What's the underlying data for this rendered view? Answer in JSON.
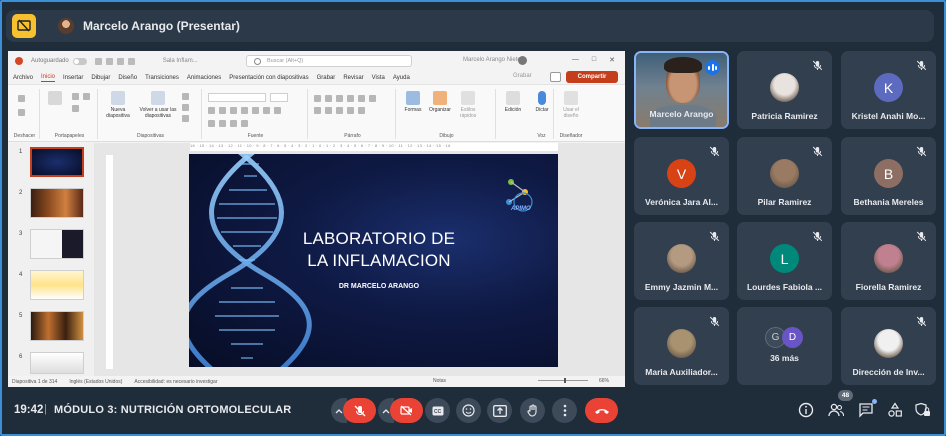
{
  "topbar": {
    "presenter_label": "Marcelo Arango (Presentar)"
  },
  "ppt": {
    "autosave_label": "Autoguardado",
    "filename": "Sala Inflam...",
    "search_placeholder": "Buscar (Alt+Q)",
    "user_name": "Marcelo Arango Nieto",
    "tabs": [
      "Archivo",
      "Inicio",
      "Insertar",
      "Dibujar",
      "Diseño",
      "Transiciones",
      "Animaciones",
      "Presentación con diapositivas",
      "Grabar",
      "Revisar",
      "Vista",
      "Ayuda"
    ],
    "grabar_label": "Grabar",
    "share_label": "Compartir",
    "ribbon": {
      "groups": [
        "Deshacer",
        "Portapapeles",
        "Diapositivas",
        "Fuente",
        "Párrafo",
        "Dibujo",
        "Voz",
        "Diseñador"
      ],
      "new_slide": "Nueva diapositiva",
      "reuse": "Volver a usar las diapositivas",
      "shapes": "Formas",
      "arrange": "Organizar",
      "quick_styles": "Estilos rápidos",
      "editing": "Edición",
      "dictate": "Dictar",
      "designer": "Usar el diseño"
    },
    "thumbnails": [
      "1",
      "2",
      "3",
      "4",
      "5",
      "6"
    ],
    "ruler_text": "16 · 15 · 14 · 13 · 12 · 11 · 10 · 9 · 8 · 7 · 6 · 5 · 4 · 3 · 2 · 1 · 0 · 1 · 2 · 3 · 4 · 5 · 6 · 7 · 8 · 9 · 10 · 11 · 12 · 13 · 14 · 15 · 16",
    "slide": {
      "title_line1": "LABORATORIO DE",
      "title_line2": "LA INFLAMACION",
      "subtitle": "DR MARCELO ARANGO",
      "logo_text": "APIMO"
    },
    "status": {
      "slide_count": "Diapositiva 1 de 314",
      "language": "Inglés (Estados Unidos)",
      "accessibility": "Accesibilidad: es necesario investigar",
      "notes": "Notas",
      "zoom": "66%"
    }
  },
  "participants": [
    {
      "name": "Marcelo Arango",
      "type": "video",
      "speaking": true
    },
    {
      "name": "Patricia Ramirez",
      "type": "photo",
      "color": "#e9e3df"
    },
    {
      "name": "Kristel Anahi Mo...",
      "type": "letter",
      "letter": "K",
      "color": "#5c6bc0"
    },
    {
      "name": "Verónica Jara Al...",
      "type": "letter",
      "letter": "V",
      "color": "#d84315"
    },
    {
      "name": "Pilar Ramirez",
      "type": "photo",
      "color": "#9a7a62"
    },
    {
      "name": "Bethania Mereles",
      "type": "letter",
      "letter": "B",
      "color": "#8d6e63"
    },
    {
      "name": "Emmy Jazmin M...",
      "type": "photo",
      "color": "#b49a80"
    },
    {
      "name": "Lourdes Fabiola ...",
      "type": "letter",
      "letter": "L",
      "color": "#00897b"
    },
    {
      "name": "Fiorella Ramirez",
      "type": "photo",
      "color": "#c08090"
    },
    {
      "name": "Maria Auxiliador...",
      "type": "photo",
      "color": "#a89270"
    },
    {
      "name": "36 más",
      "type": "more",
      "letters": [
        "G",
        "D"
      ]
    },
    {
      "name": "Dirección de Inv...",
      "type": "photo",
      "color": "#f0f0f0"
    }
  ],
  "bottombar": {
    "time": "19:42",
    "separator": "|",
    "meeting_title": "MÓDULO 3: NUTRICIÓN ORTOMOLECULAR",
    "people_count": "48"
  },
  "colors": {
    "accent": "#8ab4f8",
    "danger": "#ea4335",
    "ppt_brand": "#c43e1c",
    "present_icon": "#f6c02f"
  }
}
